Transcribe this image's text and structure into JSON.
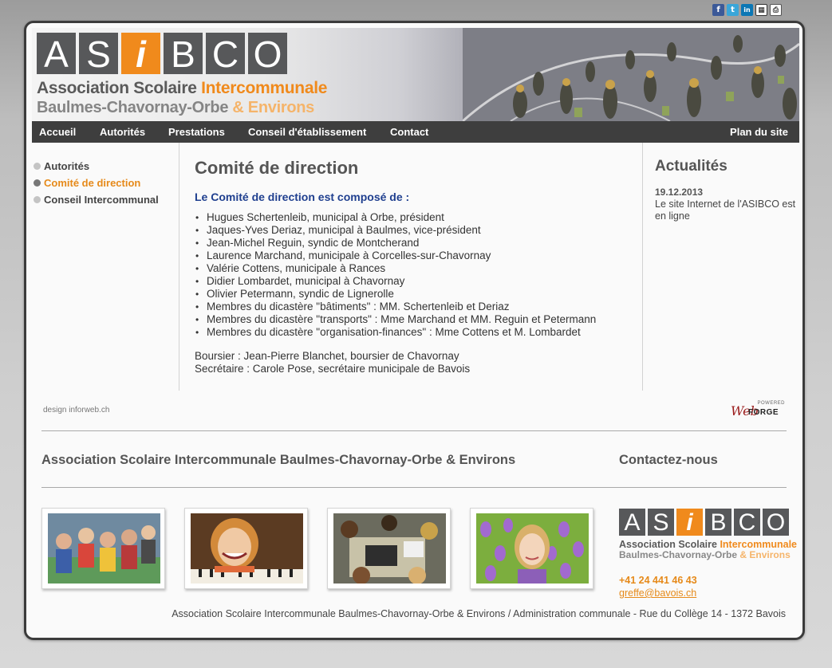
{
  "share": {
    "facebook": "f",
    "twitter": "t",
    "linkedin": "in",
    "qr": "▦",
    "print": "⎙"
  },
  "logo": {
    "letters": [
      "A",
      "S",
      "i",
      "B",
      "C",
      "O"
    ],
    "line1_a": "Association Scolaire ",
    "line1_b": "Intercommunale",
    "line2_a": "Baulmes-Chavornay-Orbe ",
    "line2_b": "& Environs"
  },
  "nav": {
    "items": [
      "Accueil",
      "Autorités",
      "Prestations",
      "Conseil d'établissement",
      "Contact"
    ],
    "sitemap": "Plan du site"
  },
  "sidebar": {
    "items": [
      {
        "label": "Autorités",
        "active": false
      },
      {
        "label": "Comité de direction",
        "active": true
      },
      {
        "label": "Conseil Intercommunal",
        "active": false
      }
    ]
  },
  "main": {
    "title": "Comité de direction",
    "subtitle": "Le Comité de direction est composé de :",
    "members": [
      "Hugues Schertenleib, municipal à Orbe, président",
      "Jaques-Yves Deriaz, municipal à Baulmes, vice-président",
      "Jean-Michel Reguin, syndic de Montcherand",
      "Laurence Marchand, municipale à Corcelles-sur-Chavornay",
      "Valérie Cottens, municipale à Rances",
      "Didier Lombardet, municipal à Chavornay",
      "Olivier Petermann, syndic de Lignerolle",
      "Membres du dicastère \"bâtiments\" : MM. Schertenleib et Deriaz",
      "Membres du dicastère \"transports\" : Mme Marchand et MM. Reguin et Petermann",
      "Membres du dicastère \"organisation-finances\" : Mme Cottens et M. Lombardet"
    ],
    "boursier": "Boursier : Jean-Pierre Blanchet, boursier de Chavornay",
    "secretaire": "Secrétaire : Carole Pose, secrétaire municipale de Bavois"
  },
  "news": {
    "title": "Actualités",
    "date": "19.12.2013",
    "text": "Le site Internet de l'ASIBCO est en ligne"
  },
  "footer": {
    "design": "design inforweb.ch",
    "powered": "POWERED",
    "powered_brand_a": "Web",
    "powered_brand_b": "FORGE",
    "title": "Association Scolaire Intercommunale Baulmes-Chavornay-Orbe & Environs",
    "contact_title": "Contactez-nous",
    "phone": "+41 24 441 46 43",
    "email": "greffe@bavois.ch",
    "address": "Association Scolaire Intercommunale Baulmes-Chavornay-Orbe & Environs / Administration communale - Rue du Collège 14 - 1372 Bavois"
  }
}
